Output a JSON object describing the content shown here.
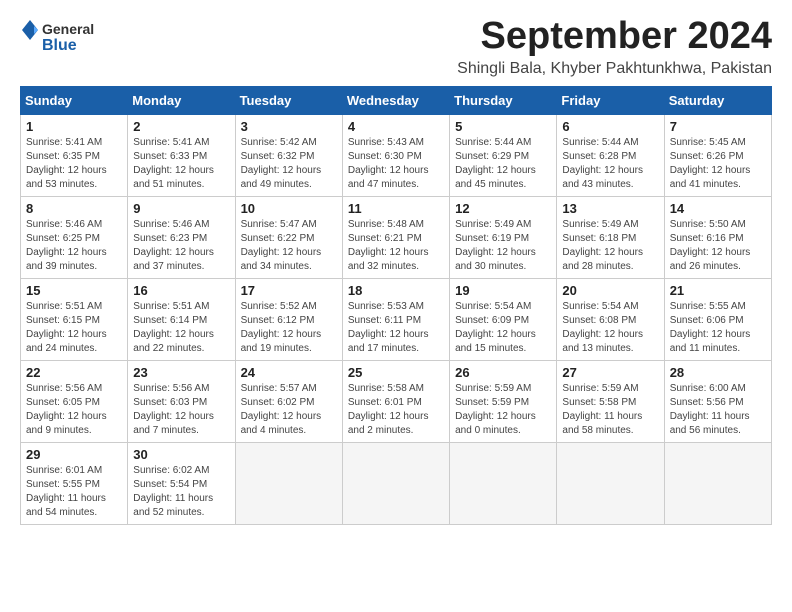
{
  "logo": {
    "general": "General",
    "blue": "Blue"
  },
  "title": "September 2024",
  "location": "Shingli Bala, Khyber Pakhtunkhwa, Pakistan",
  "days_of_week": [
    "Sunday",
    "Monday",
    "Tuesday",
    "Wednesday",
    "Thursday",
    "Friday",
    "Saturday"
  ],
  "weeks": [
    [
      {
        "day": 1,
        "sunrise": "5:41 AM",
        "sunset": "6:35 PM",
        "daylight": "12 hours and 53 minutes."
      },
      {
        "day": 2,
        "sunrise": "5:41 AM",
        "sunset": "6:33 PM",
        "daylight": "12 hours and 51 minutes."
      },
      {
        "day": 3,
        "sunrise": "5:42 AM",
        "sunset": "6:32 PM",
        "daylight": "12 hours and 49 minutes."
      },
      {
        "day": 4,
        "sunrise": "5:43 AM",
        "sunset": "6:30 PM",
        "daylight": "12 hours and 47 minutes."
      },
      {
        "day": 5,
        "sunrise": "5:44 AM",
        "sunset": "6:29 PM",
        "daylight": "12 hours and 45 minutes."
      },
      {
        "day": 6,
        "sunrise": "5:44 AM",
        "sunset": "6:28 PM",
        "daylight": "12 hours and 43 minutes."
      },
      {
        "day": 7,
        "sunrise": "5:45 AM",
        "sunset": "6:26 PM",
        "daylight": "12 hours and 41 minutes."
      }
    ],
    [
      {
        "day": 8,
        "sunrise": "5:46 AM",
        "sunset": "6:25 PM",
        "daylight": "12 hours and 39 minutes."
      },
      {
        "day": 9,
        "sunrise": "5:46 AM",
        "sunset": "6:23 PM",
        "daylight": "12 hours and 37 minutes."
      },
      {
        "day": 10,
        "sunrise": "5:47 AM",
        "sunset": "6:22 PM",
        "daylight": "12 hours and 34 minutes."
      },
      {
        "day": 11,
        "sunrise": "5:48 AM",
        "sunset": "6:21 PM",
        "daylight": "12 hours and 32 minutes."
      },
      {
        "day": 12,
        "sunrise": "5:49 AM",
        "sunset": "6:19 PM",
        "daylight": "12 hours and 30 minutes."
      },
      {
        "day": 13,
        "sunrise": "5:49 AM",
        "sunset": "6:18 PM",
        "daylight": "12 hours and 28 minutes."
      },
      {
        "day": 14,
        "sunrise": "5:50 AM",
        "sunset": "6:16 PM",
        "daylight": "12 hours and 26 minutes."
      }
    ],
    [
      {
        "day": 15,
        "sunrise": "5:51 AM",
        "sunset": "6:15 PM",
        "daylight": "12 hours and 24 minutes."
      },
      {
        "day": 16,
        "sunrise": "5:51 AM",
        "sunset": "6:14 PM",
        "daylight": "12 hours and 22 minutes."
      },
      {
        "day": 17,
        "sunrise": "5:52 AM",
        "sunset": "6:12 PM",
        "daylight": "12 hours and 19 minutes."
      },
      {
        "day": 18,
        "sunrise": "5:53 AM",
        "sunset": "6:11 PM",
        "daylight": "12 hours and 17 minutes."
      },
      {
        "day": 19,
        "sunrise": "5:54 AM",
        "sunset": "6:09 PM",
        "daylight": "12 hours and 15 minutes."
      },
      {
        "day": 20,
        "sunrise": "5:54 AM",
        "sunset": "6:08 PM",
        "daylight": "12 hours and 13 minutes."
      },
      {
        "day": 21,
        "sunrise": "5:55 AM",
        "sunset": "6:06 PM",
        "daylight": "12 hours and 11 minutes."
      }
    ],
    [
      {
        "day": 22,
        "sunrise": "5:56 AM",
        "sunset": "6:05 PM",
        "daylight": "12 hours and 9 minutes."
      },
      {
        "day": 23,
        "sunrise": "5:56 AM",
        "sunset": "6:03 PM",
        "daylight": "12 hours and 7 minutes."
      },
      {
        "day": 24,
        "sunrise": "5:57 AM",
        "sunset": "6:02 PM",
        "daylight": "12 hours and 4 minutes."
      },
      {
        "day": 25,
        "sunrise": "5:58 AM",
        "sunset": "6:01 PM",
        "daylight": "12 hours and 2 minutes."
      },
      {
        "day": 26,
        "sunrise": "5:59 AM",
        "sunset": "5:59 PM",
        "daylight": "12 hours and 0 minutes."
      },
      {
        "day": 27,
        "sunrise": "5:59 AM",
        "sunset": "5:58 PM",
        "daylight": "11 hours and 58 minutes."
      },
      {
        "day": 28,
        "sunrise": "6:00 AM",
        "sunset": "5:56 PM",
        "daylight": "11 hours and 56 minutes."
      }
    ],
    [
      {
        "day": 29,
        "sunrise": "6:01 AM",
        "sunset": "5:55 PM",
        "daylight": "11 hours and 54 minutes."
      },
      {
        "day": 30,
        "sunrise": "6:02 AM",
        "sunset": "5:54 PM",
        "daylight": "11 hours and 52 minutes."
      },
      null,
      null,
      null,
      null,
      null
    ]
  ]
}
